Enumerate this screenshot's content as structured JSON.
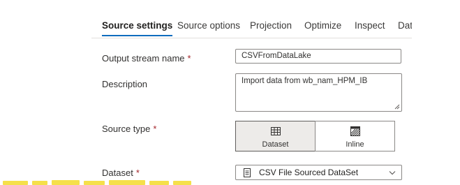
{
  "tabs": [
    {
      "label": "Source settings",
      "active": true
    },
    {
      "label": "Source options",
      "active": false
    },
    {
      "label": "Projection",
      "active": false
    },
    {
      "label": "Optimize",
      "active": false
    },
    {
      "label": "Inspect",
      "active": false
    },
    {
      "label": "Dat",
      "active": false
    }
  ],
  "form": {
    "output_stream_name": {
      "label": "Output stream name",
      "required_mark": "*",
      "value": "CSVFromDataLake"
    },
    "description": {
      "label": "Description",
      "value": "Import data from wb_nam_HPM_IB"
    },
    "source_type": {
      "label": "Source type",
      "required_mark": "*",
      "options": [
        {
          "label": "Dataset",
          "icon": "table-icon",
          "selected": true
        },
        {
          "label": "Inline",
          "icon": "hatched-box-icon",
          "selected": false
        }
      ]
    },
    "dataset": {
      "label": "Dataset",
      "required_mark": "*",
      "value": "CSV File Sourced DataSet",
      "icon": "document-icon"
    }
  },
  "colors": {
    "accent": "#0f6cbd",
    "required": "#a4262c",
    "caption_fragment": "#f5e04a"
  }
}
